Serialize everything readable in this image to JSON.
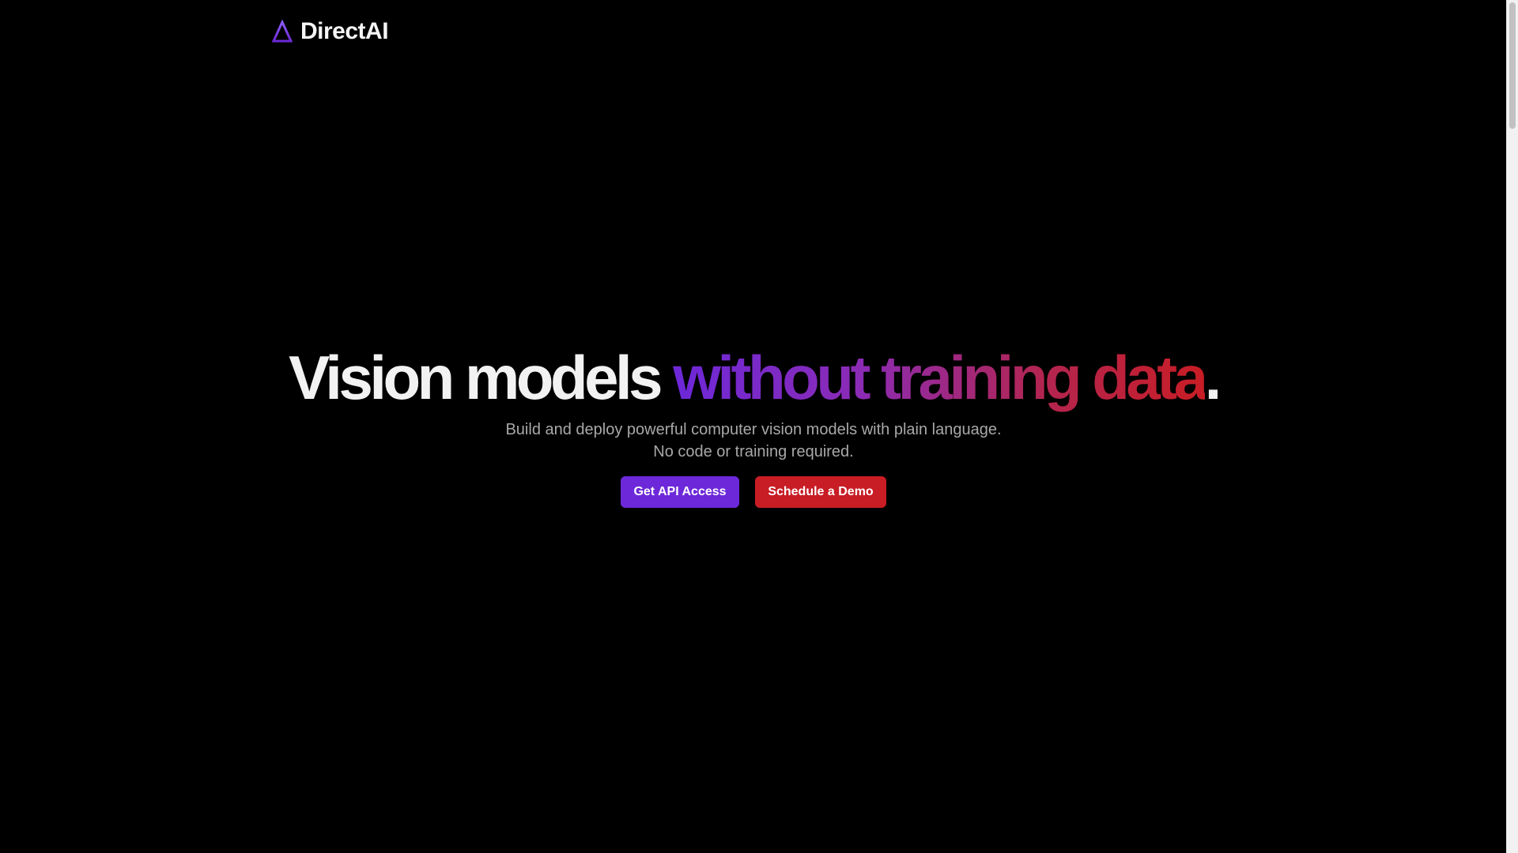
{
  "brand": {
    "name": "DirectAI",
    "logo_icon": "triangle-outline-icon",
    "logo_color": "#7c3aed"
  },
  "hero": {
    "headline_lead": "Vision models ",
    "headline_highlight": "without training data",
    "headline_end": ".",
    "subtitle_line1": "Build and deploy powerful computer vision models with plain language.",
    "subtitle_line2": "No code or training required.",
    "gradient_colors": [
      "#6d28d9",
      "#8b2bb5",
      "#b3254f",
      "#c81d25"
    ]
  },
  "actions": {
    "api_label": "Get API Access",
    "api_color": "#6d28d9",
    "demo_label": "Schedule a Demo",
    "demo_color": "#c81d25"
  },
  "colors": {
    "background": "#000000",
    "text_primary": "#f2f2f2",
    "text_muted": "#a8a8a8"
  }
}
